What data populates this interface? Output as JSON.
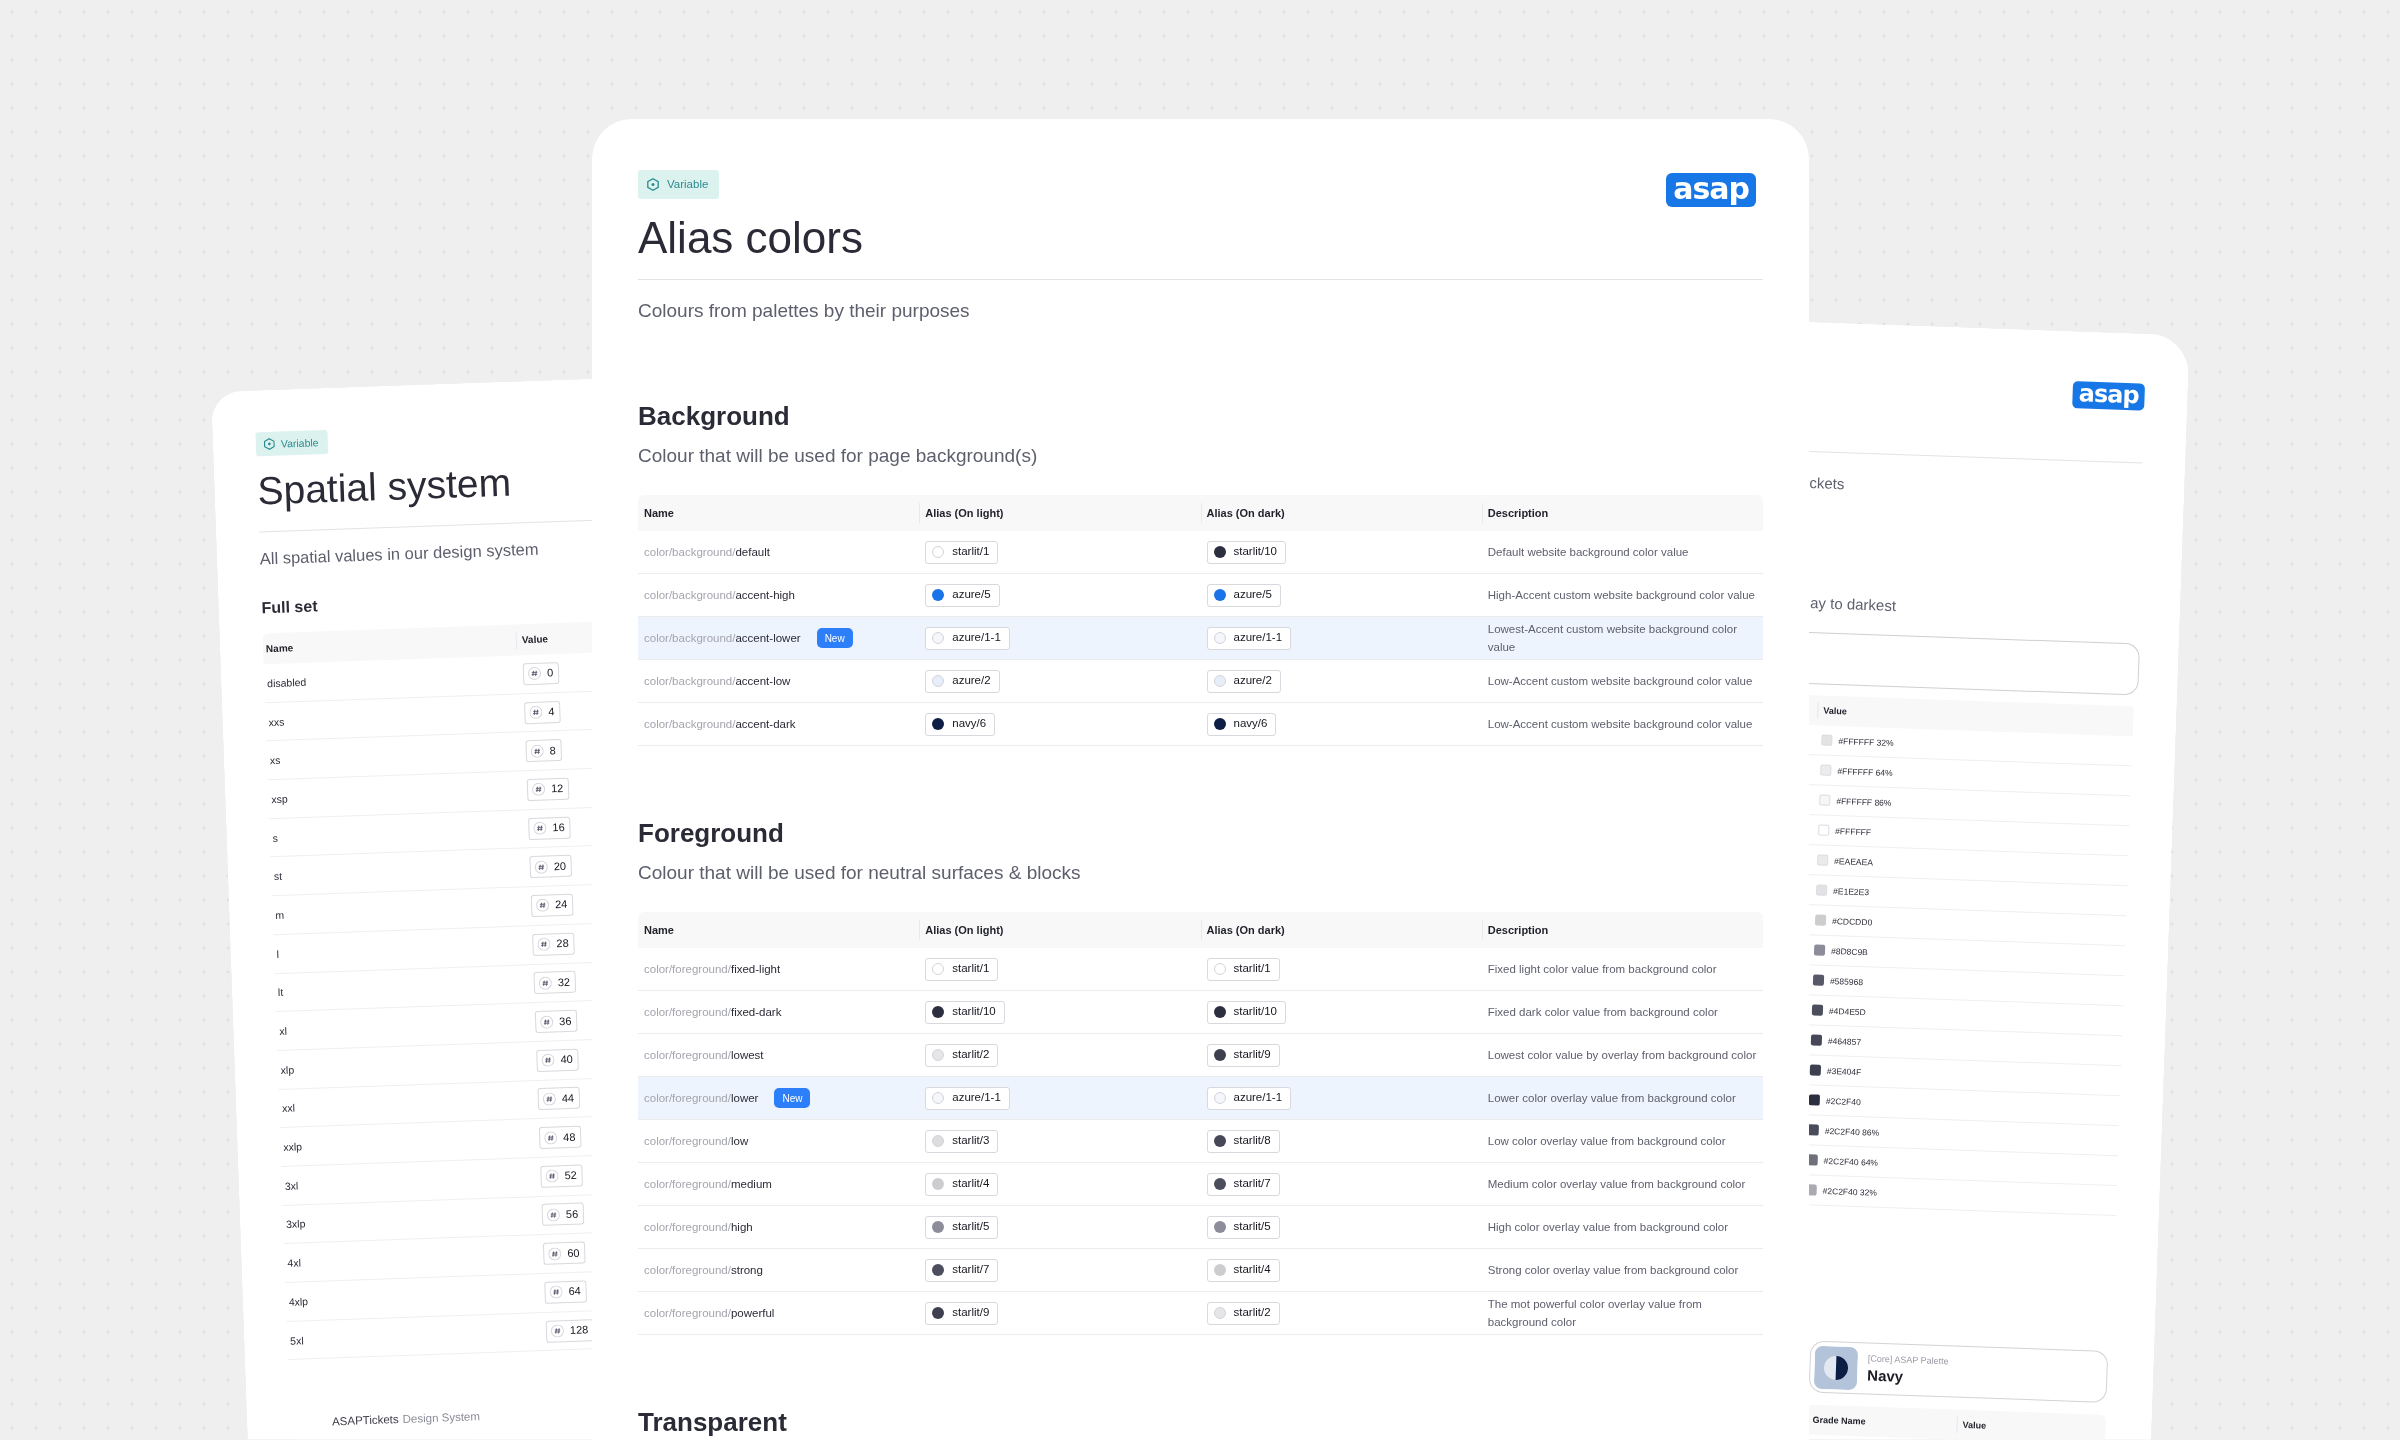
{
  "spatial_card": {
    "tag": "Variable",
    "title": "Spatial system",
    "subtitle": "All spatial values in our design system",
    "section": "Full set",
    "table": {
      "columns": [
        "Name",
        "Value"
      ],
      "rows": [
        {
          "name": "disabled",
          "value": "0"
        },
        {
          "name": "xxs",
          "value": "4"
        },
        {
          "name": "xs",
          "value": "8"
        },
        {
          "name": "xsp",
          "value": "12"
        },
        {
          "name": "s",
          "value": "16"
        },
        {
          "name": "st",
          "value": "20"
        },
        {
          "name": "m",
          "value": "24"
        },
        {
          "name": "l",
          "value": "28"
        },
        {
          "name": "lt",
          "value": "32"
        },
        {
          "name": "xl",
          "value": "36"
        },
        {
          "name": "xlp",
          "value": "40"
        },
        {
          "name": "xxl",
          "value": "44"
        },
        {
          "name": "xxlp",
          "value": "48"
        },
        {
          "name": "3xl",
          "value": "52"
        },
        {
          "name": "3xlp",
          "value": "56"
        },
        {
          "name": "4xl",
          "value": "60"
        },
        {
          "name": "4xlp",
          "value": "64"
        },
        {
          "name": "5xl",
          "value": "128"
        }
      ]
    },
    "footer": {
      "brand": "ASAPTickets",
      "label": "Design System"
    }
  },
  "alias_card": {
    "tag": "Variable",
    "logo": "asap",
    "title": "Alias colors",
    "subtitle": "Colours from palettes by their purposes",
    "sections": [
      {
        "heading": "Background",
        "description": "Colour that will be used for page background(s)",
        "table": {
          "columns": [
            "Name",
            "Alias (On light)",
            "Alias (On dark)",
            "Description"
          ],
          "rows": [
            {
              "name": "color/background/default",
              "highlighted": false,
              "on_light": {
                "label": "starlit/1",
                "color": "#ffffff"
              },
              "on_dark": {
                "label": "starlit/10",
                "color": "#2c2f40"
              },
              "description": "Default website background color value"
            },
            {
              "name": "color/background/accent-high",
              "highlighted": false,
              "on_light": {
                "label": "azure/5",
                "color": "#1a73e8"
              },
              "on_dark": {
                "label": "azure/5",
                "color": "#1a73e8"
              },
              "description": "High-Accent custom website background color value"
            },
            {
              "name": "color/background/accent-lower",
              "badge": "New",
              "highlighted": true,
              "on_light": {
                "label": "azure/1-1",
                "color": "#f4f6fb"
              },
              "on_dark": {
                "label": "azure/1-1",
                "color": "#f4f6fb"
              },
              "description": "Lowest-Accent custom website background color value"
            },
            {
              "name": "color/background/accent-low",
              "highlighted": false,
              "on_light": {
                "label": "azure/2",
                "color": "#e6eefa"
              },
              "on_dark": {
                "label": "azure/2",
                "color": "#e6eefa"
              },
              "description": "Low-Accent custom website background color value"
            },
            {
              "name": "color/background/accent-dark",
              "highlighted": false,
              "on_light": {
                "label": "navy/6",
                "color": "#0e1f45"
              },
              "on_dark": {
                "label": "navy/6",
                "color": "#0e1f45"
              },
              "description": "Low-Accent custom website background color value"
            }
          ]
        }
      },
      {
        "heading": "Foreground",
        "description": "Colour that will be used for neutral surfaces & blocks",
        "table": {
          "columns": [
            "Name",
            "Alias (On light)",
            "Alias (On dark)",
            "Description"
          ],
          "rows": [
            {
              "name": "color/foreground/fixed-light",
              "highlighted": false,
              "on_light": {
                "label": "starlit/1",
                "color": "#ffffff"
              },
              "on_dark": {
                "label": "starlit/1",
                "color": "#ffffff"
              },
              "description": "Fixed light color value from background color"
            },
            {
              "name": "color/foreground/fixed-dark",
              "highlighted": false,
              "on_light": {
                "label": "starlit/10",
                "color": "#2c2f40"
              },
              "on_dark": {
                "label": "starlit/10",
                "color": "#2c2f40"
              },
              "description": "Fixed dark color value from background color"
            },
            {
              "name": "color/foreground/lowest",
              "highlighted": false,
              "on_light": {
                "label": "starlit/2",
                "color": "#e6e6e8"
              },
              "on_dark": {
                "label": "starlit/9",
                "color": "#3e404f"
              },
              "description": "Lowest color value by overlay from background color"
            },
            {
              "name": "color/foreground/lower",
              "badge": "New",
              "highlighted": true,
              "on_light": {
                "label": "azure/1-1",
                "color": "#f4f6fb"
              },
              "on_dark": {
                "label": "azure/1-1",
                "color": "#f4f6fb"
              },
              "description": "Lower color overlay value from background color"
            },
            {
              "name": "color/foreground/low",
              "highlighted": false,
              "on_light": {
                "label": "starlit/3",
                "color": "#dddde0"
              },
              "on_dark": {
                "label": "starlit/8",
                "color": "#464857"
              },
              "description": "Low color overlay value from background color"
            },
            {
              "name": "color/foreground/medium",
              "highlighted": false,
              "on_light": {
                "label": "starlit/4",
                "color": "#cdcdd0"
              },
              "on_dark": {
                "label": "starlit/7",
                "color": "#4d4e5d"
              },
              "description": "Medium color overlay value from background color"
            },
            {
              "name": "color/foreground/high",
              "highlighted": false,
              "on_light": {
                "label": "starlit/5",
                "color": "#8d8c9b"
              },
              "on_dark": {
                "label": "starlit/5",
                "color": "#8d8c9b"
              },
              "description": "High color overlay value from background color"
            },
            {
              "name": "color/foreground/strong",
              "highlighted": false,
              "on_light": {
                "label": "starlit/7",
                "color": "#4d4e5d"
              },
              "on_dark": {
                "label": "starlit/4",
                "color": "#cdcdd0"
              },
              "description": "Strong color overlay value from background color"
            },
            {
              "name": "color/foreground/powerful",
              "highlighted": false,
              "on_light": {
                "label": "starlit/9",
                "color": "#3e404f"
              },
              "on_dark": {
                "label": "starlit/2",
                "color": "#e6e6e8"
              },
              "description": "The mot powerful color overlay value from background color"
            }
          ]
        }
      },
      {
        "heading": "Transparent"
      }
    ]
  },
  "palette_card": {
    "logo": "asap",
    "subtitle": "ckets",
    "section_description": "ay to darkest",
    "table": {
      "columns": [
        "Value"
      ],
      "rows": [
        {
          "value": "#FFFFFF 32%",
          "color": "#e3e3e4"
        },
        {
          "value": "#FFFFFF 64%",
          "color": "#ececed"
        },
        {
          "value": "#FFFFFF 86%",
          "color": "#f6f6f6"
        },
        {
          "value": "#FFFFFF",
          "color": "#ffffff"
        },
        {
          "value": "#EAEAEA",
          "color": "#eaeaea"
        },
        {
          "value": "#E1E2E3",
          "color": "#e1e2e3"
        },
        {
          "value": "#CDCDD0",
          "color": "#cdcdd0"
        },
        {
          "value": "#8D8C9B",
          "color": "#8d8c9b"
        },
        {
          "value": "#585968",
          "color": "#585968"
        },
        {
          "value": "#4D4E5D",
          "color": "#4d4e5d"
        },
        {
          "value": "#464857",
          "color": "#464857"
        },
        {
          "value": "#3E404F",
          "color": "#3e404f"
        },
        {
          "value": "#2C2F40",
          "color": "#2c2f40"
        },
        {
          "value": "#2C2F40 86%",
          "color": "#4a4c5b"
        },
        {
          "value": "#2C2F40 64%",
          "color": "#6e707c"
        },
        {
          "value": "#2C2F40 32%",
          "color": "#a9aab2"
        }
      ]
    },
    "palette": {
      "caption": "[Core] ASAP Palette",
      "name": "Navy"
    },
    "grade_table": {
      "columns": [
        "Grade Name",
        "Value"
      ]
    }
  }
}
